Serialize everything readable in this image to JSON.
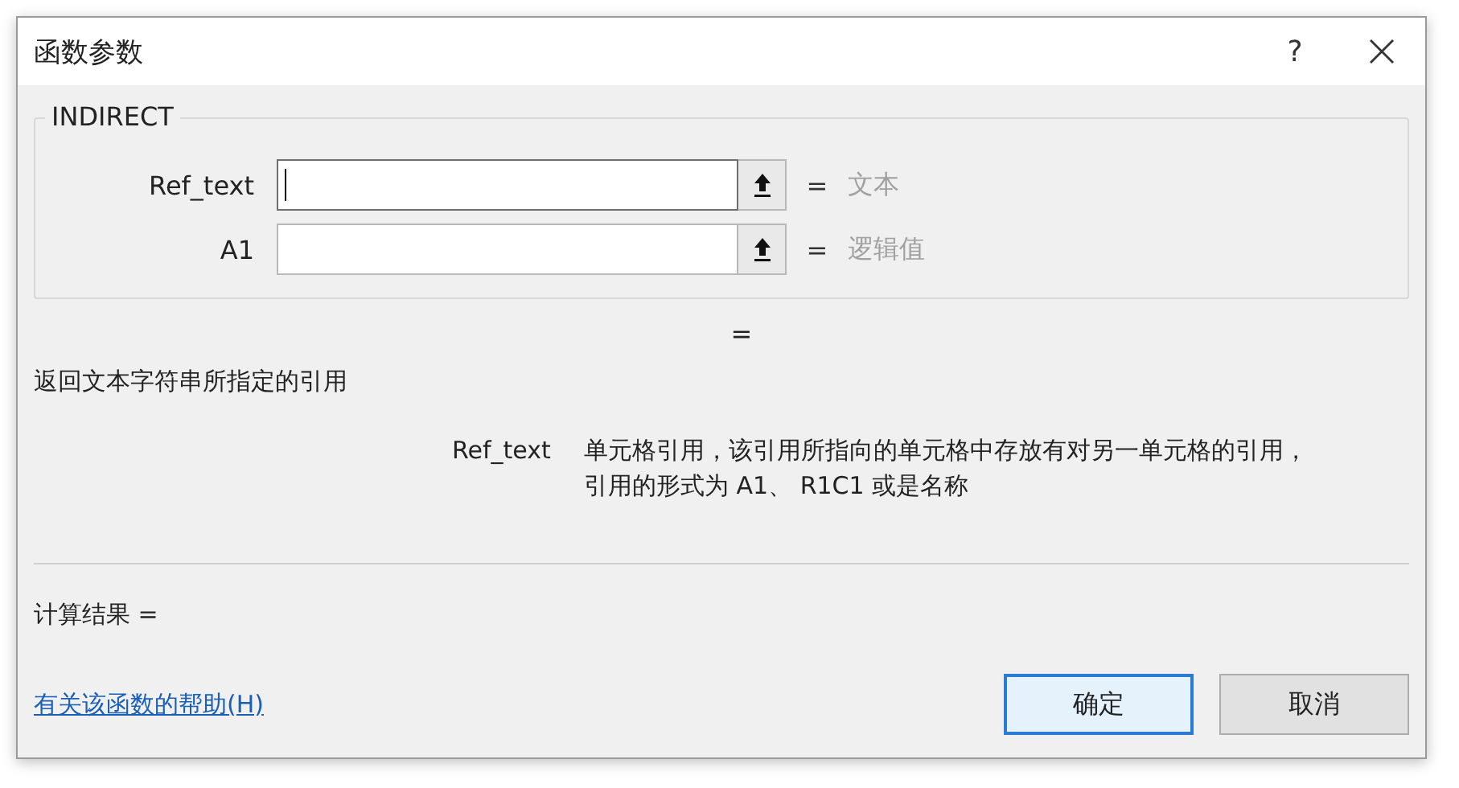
{
  "window": {
    "title": "函数参数",
    "help": "?"
  },
  "function": {
    "name": "INDIRECT",
    "args": [
      {
        "label": "Ref_text",
        "focused": true,
        "equals": "=",
        "hint": "文本"
      },
      {
        "label": "A1",
        "focused": false,
        "equals": "=",
        "hint": "逻辑值"
      }
    ],
    "result_equals": "="
  },
  "description": "返回文本字符串所指定的引用",
  "argument_help": {
    "name": "Ref_text",
    "lines": [
      "单元格引用，该引用所指向的单元格中存放有对另一单元格的引用，",
      "引用的形式为 A1、 R1C1 或是名称"
    ]
  },
  "calc_result": "计算结果 =",
  "help_link": "有关该函数的帮助(H)",
  "buttons": [
    {
      "label": "确定",
      "default": true
    },
    {
      "label": "取消",
      "default": false
    }
  ]
}
